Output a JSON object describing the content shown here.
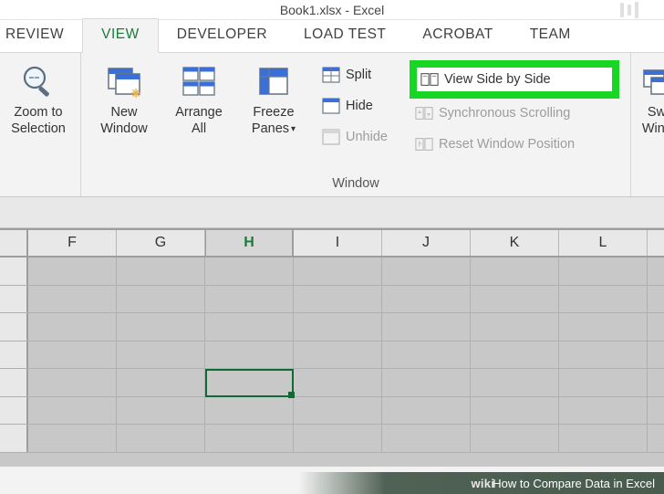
{
  "title": "Book1.xlsx - Excel",
  "tabs": [
    {
      "id": "review",
      "label": "REVIEW"
    },
    {
      "id": "view",
      "label": "VIEW"
    },
    {
      "id": "developer",
      "label": "DEVELOPER"
    },
    {
      "id": "loadtest",
      "label": "LOAD TEST"
    },
    {
      "id": "acrobat",
      "label": "ACROBAT"
    },
    {
      "id": "team",
      "label": "TEAM"
    }
  ],
  "ribbon": {
    "zoom": {
      "zoom_to_selection": "Zoom to\nSelection"
    },
    "window": {
      "group_label": "Window",
      "new_window": "New\nWindow",
      "arrange_all": "Arrange\nAll",
      "freeze_panes": "Freeze\nPanes",
      "split": "Split",
      "hide": "Hide",
      "unhide": "Unhide",
      "view_side_by_side": "View Side by Side",
      "synchronous_scrolling": "Synchronous Scrolling",
      "reset_window_position": "Reset Window Position",
      "switch_windows": "Sw\nWinc"
    }
  },
  "columns": [
    "F",
    "G",
    "H",
    "I",
    "J",
    "K",
    "L"
  ],
  "active_column": "H",
  "selected_cell": {
    "col": "H",
    "row_index": 4
  },
  "footer": {
    "brand": "wiki",
    "caption": "How to Compare Data in Excel"
  }
}
